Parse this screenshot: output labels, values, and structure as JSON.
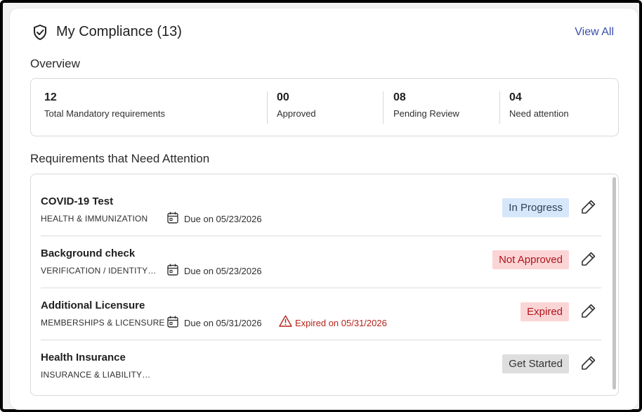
{
  "header": {
    "title": "My Compliance (13)",
    "view_all": "View All",
    "icon": "shield-check-icon"
  },
  "overview": {
    "title": "Overview",
    "stats": [
      {
        "value": "12",
        "label": "Total Mandatory requirements"
      },
      {
        "value": "00",
        "label": "Approved"
      },
      {
        "value": "08",
        "label": "Pending Review"
      },
      {
        "value": "04",
        "label": "Need attention"
      }
    ]
  },
  "attention": {
    "title": "Requirements that Need Attention",
    "items": [
      {
        "name": "COVID-19 Test",
        "category": "HEALTH & IMMUNIZATION",
        "due": "Due on 05/23/2026",
        "expired": "",
        "status": "In Progress",
        "status_color": "#d6e7fb"
      },
      {
        "name": "Background check",
        "category": "VERIFICATION / IDENTITY…",
        "due": "Due on 05/23/2026",
        "expired": "",
        "status": "Not Approved",
        "status_color": "#fbd5d6"
      },
      {
        "name": "Additional Licensure",
        "category": "MEMBERSHIPS & LICENSURE",
        "due": "Due on 05/31/2026",
        "expired": "Expired on 05/31/2026",
        "status": "Expired",
        "status_color": "#fbd5d6"
      },
      {
        "name": "Health Insurance",
        "category": "INSURANCE & LIABILITY…",
        "due": "",
        "expired": "",
        "status": "Get Started",
        "status_color": "#dedede"
      }
    ]
  },
  "colors": {
    "link": "#3a4ea8",
    "error": "#b42318"
  }
}
